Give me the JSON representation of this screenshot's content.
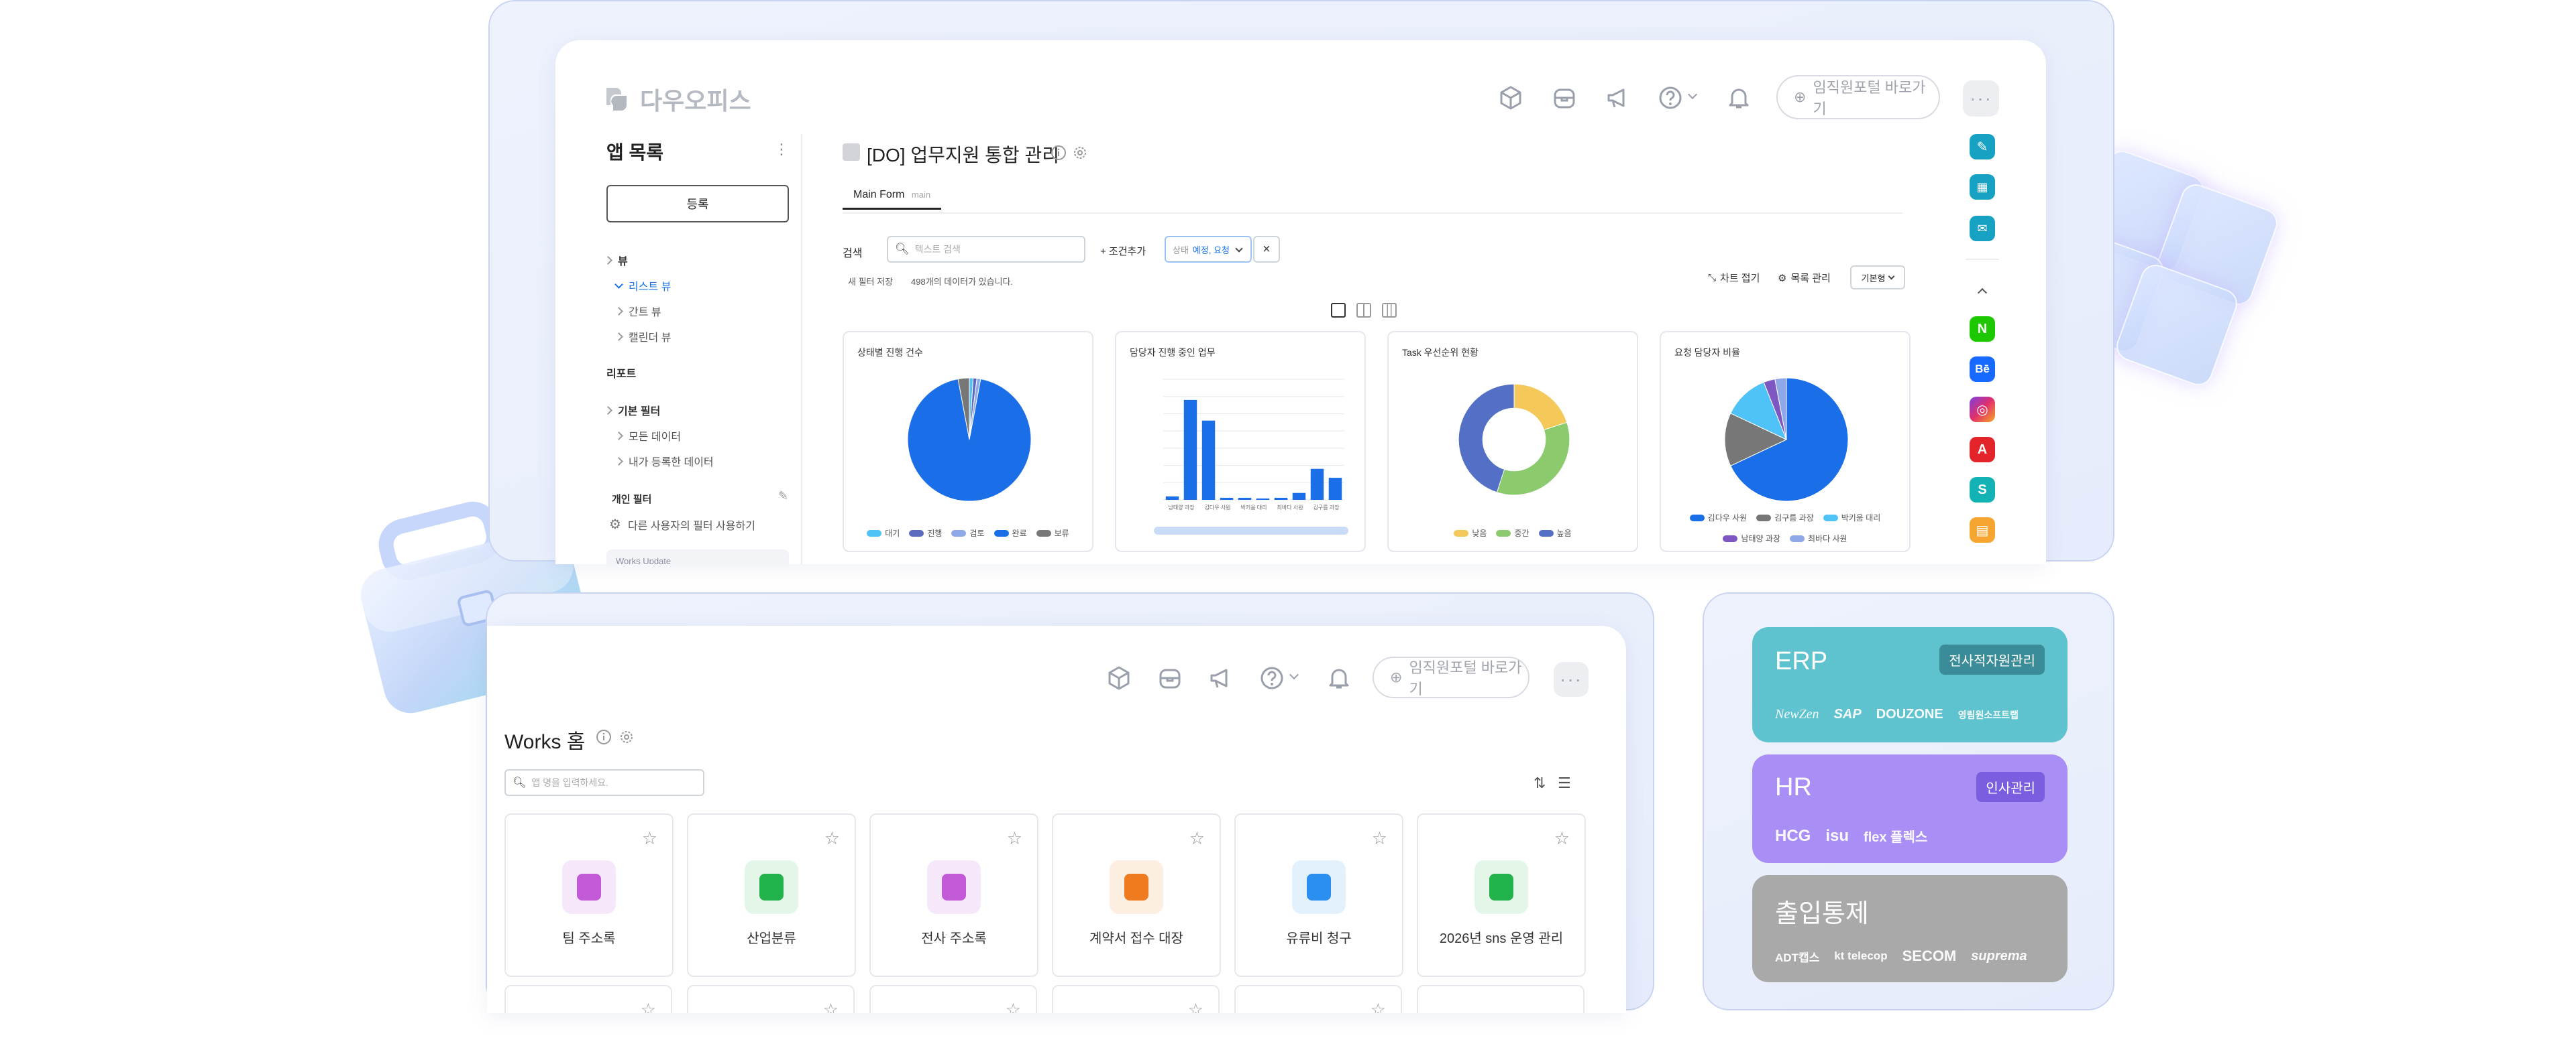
{
  "top_window": {
    "logo_text": "다우오피스",
    "portal_button": "임직원포털 바로가기",
    "sidebar": {
      "title": "앱 목록",
      "register_button": "등록",
      "sections": [
        {
          "label": "뷰"
        },
        {
          "label": "리스트 뷰"
        },
        {
          "label": "간트 뷰"
        },
        {
          "label": "캘린더 뷰"
        },
        {
          "label": "리포트"
        },
        {
          "label": "기본 필터"
        },
        {
          "label": "모든 데이터"
        },
        {
          "label": "내가 등록한 데이터"
        },
        {
          "label": "개인 필터"
        },
        {
          "label": "다른 사용자의 필터 사용하기"
        },
        {
          "label": "Works Update"
        }
      ]
    },
    "page_title": "[DO] 업무지원 통합 관리",
    "tab_main": "Main Form",
    "tab_main_sub": "main",
    "search_label": "검색",
    "search_placeholder": "텍스트 검색",
    "add_condition": "+ 조건추가",
    "filter_chip_prefix": "상태",
    "filter_chip_value": "예정, 요청",
    "save_new_filter": "새 필터 저장",
    "data_count": "498개의 데이터가 있습니다.",
    "collapse_chart": "차트 접기",
    "list_manage": "목록 관리",
    "view_mode": "기본형",
    "charts": [
      {
        "title": "상태별 진행 건수",
        "legend": [
          "대기",
          "진행",
          "검토",
          "완료",
          "보류"
        ]
      },
      {
        "title": "담당자 진행 중인 업무"
      },
      {
        "title": "Task 우선순위 현황",
        "legend": [
          "낮음",
          "중간",
          "높음"
        ]
      },
      {
        "title": "요청 담당자 비율",
        "legend": [
          "김다우 사원",
          "김구름 과장",
          "박키움 대리",
          "남태양 과장",
          "최바다 사원"
        ]
      }
    ]
  },
  "chart_data": [
    {
      "type": "pie",
      "title": "상태별 진행 건수",
      "labels": [
        "대기",
        "진행",
        "검토",
        "완료",
        "보류"
      ],
      "values": [
        1,
        1,
        1,
        96,
        3
      ],
      "colors": [
        "#4fc3f7",
        "#5c6bc0",
        "#8fa8e8",
        "#1a6fe8",
        "#777777"
      ]
    },
    {
      "type": "bar",
      "title": "담당자 진행 중인 업무",
      "categories": [
        "남태양 과장",
        "",
        "김다우 사원",
        "",
        "박키움 대리",
        "",
        "최바다 사원",
        "",
        "김구름 과장",
        ""
      ],
      "values": [
        5,
        145,
        115,
        3,
        3,
        2,
        3,
        10,
        45,
        32
      ],
      "ylim": [
        0,
        175
      ],
      "color": "#1a6fe8"
    },
    {
      "type": "pie",
      "title": "Task 우선순위 현황",
      "labels": [
        "낮음",
        "중간",
        "높음"
      ],
      "values": [
        20,
        35,
        45
      ],
      "colors": [
        "#f5c85a",
        "#8cca6e",
        "#5470c6"
      ]
    },
    {
      "type": "pie",
      "title": "요청 담당자 비율",
      "labels": [
        "김다우 사원",
        "김구름 과장",
        "박키움 대리",
        "남태양 과장",
        "최바다 사원"
      ],
      "values": [
        68,
        14,
        12,
        3,
        3
      ],
      "colors": [
        "#1a6fe8",
        "#777777",
        "#4fc3f7",
        "#7e57c2",
        "#8fa8e8"
      ]
    }
  ],
  "bottom_window": {
    "portal_button": "임직원포털 바로가기",
    "title": "Works 홈",
    "search_placeholder": "앱 명을 입력하세요.",
    "apps": [
      {
        "label": "팀 주소록",
        "bg": "#f6e8fb",
        "fg": "#c25ad8"
      },
      {
        "label": "산업분류",
        "bg": "#e3f6e8",
        "fg": "#22b34a"
      },
      {
        "label": "전사 주소록",
        "bg": "#f6e8fb",
        "fg": "#c25ad8"
      },
      {
        "label": "계약서 접수 대장",
        "bg": "#fdeee2",
        "fg": "#f07b1e"
      },
      {
        "label": "유류비 청구",
        "bg": "#e3f1fd",
        "fg": "#2a8ff0"
      },
      {
        "label": "2026년 sns 운영 관리",
        "bg": "#e3f6e8",
        "fg": "#22b34a"
      }
    ]
  },
  "products": [
    {
      "name": "ERP",
      "tag": "전사적자원관리",
      "logos": [
        "NewZen",
        "SAP",
        "DOUZONE",
        "영림원소프트랩"
      ],
      "color": "#5fc3cf",
      "tag_color": "#3a8d98"
    },
    {
      "name": "HR",
      "tag": "인사관리",
      "logos": [
        "HCG",
        "isu",
        "flex 플렉스"
      ],
      "color": "#a98ef5",
      "tag_color": "#7b5ee0"
    },
    {
      "name": "출입통제",
      "tag": "",
      "logos": [
        "ADT캡스",
        "kt telecop",
        "SECOM",
        "suprema"
      ],
      "color": "#a9a9a9",
      "tag_color": ""
    }
  ]
}
